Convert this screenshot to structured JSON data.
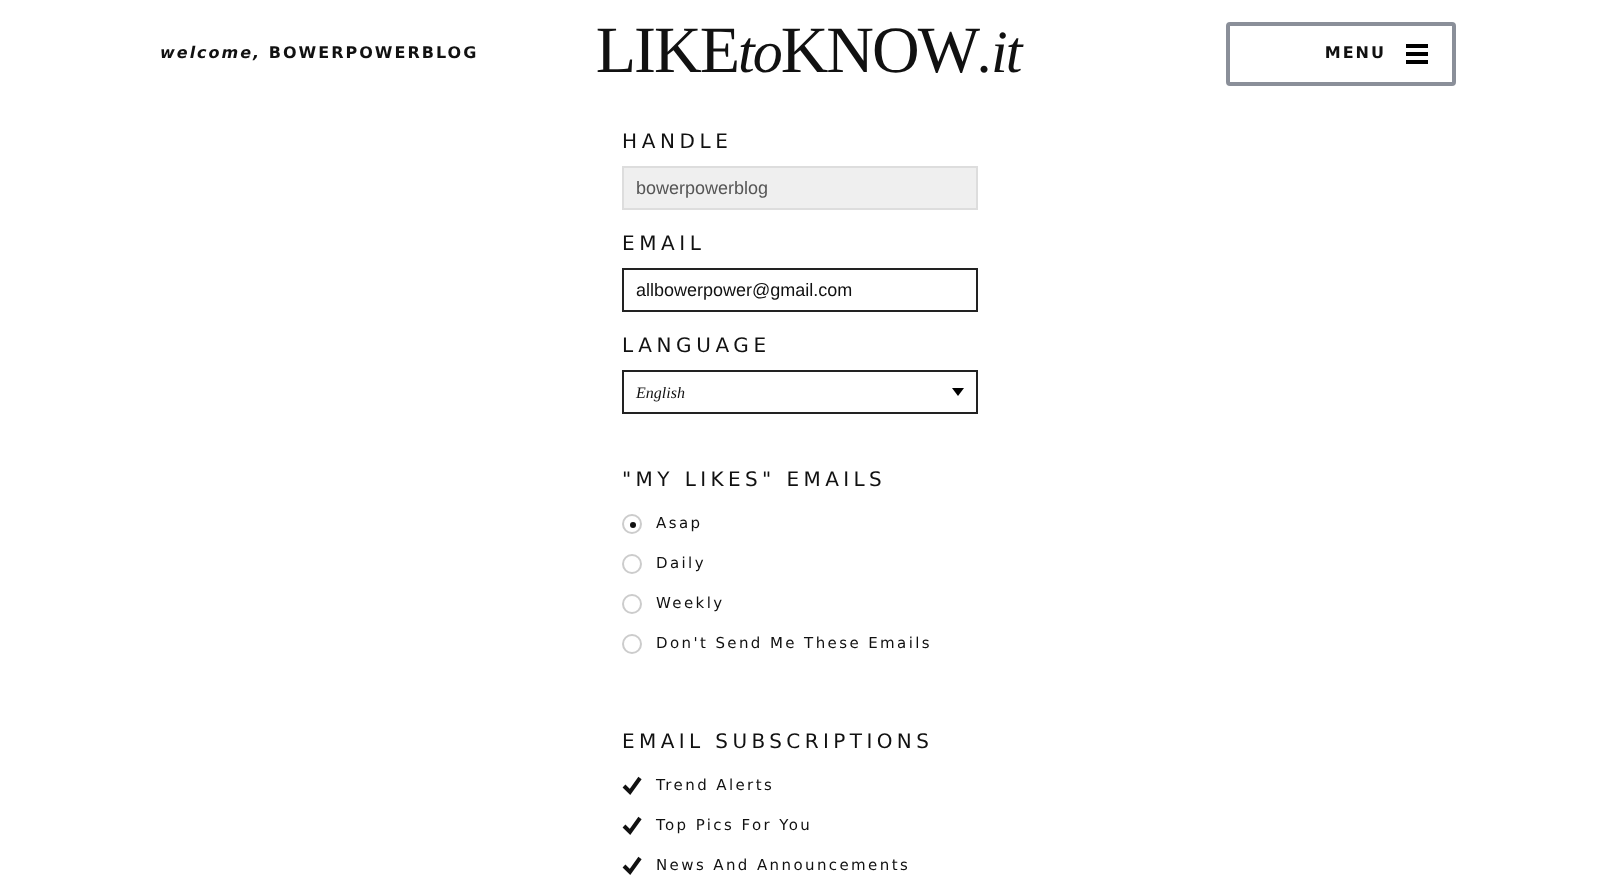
{
  "header": {
    "welcome": "*welcome,* BOWERPOWERBLOG",
    "logo": [
      {
        "text": "LIKE",
        "italic": false
      },
      {
        "text": "to",
        "italic": true
      },
      {
        "text": "KNOW",
        "italic": false
      },
      {
        "text": ".it",
        "italic": true
      }
    ],
    "menu_button": "MENU"
  },
  "form": {
    "handle": {
      "label": "HANDLE",
      "value": "bowerpowerblog",
      "disabled": true
    },
    "email": {
      "label": "EMAIL",
      "value": "allbowerpower@gmail.com",
      "disabled": false
    },
    "language": {
      "label": "LANGUAGE",
      "value": "English"
    }
  },
  "my_likes_emails": {
    "title": "\"MY LIKES\" EMAILS",
    "options": [
      {
        "label": "Asap",
        "selected": true
      },
      {
        "label": "Daily",
        "selected": false
      },
      {
        "label": "Weekly",
        "selected": false
      },
      {
        "label": "Don't Send Me These Emails",
        "selected": false
      }
    ]
  },
  "email_subscriptions": {
    "title": "EMAIL SUBSCRIPTIONS",
    "items": [
      {
        "label": "Trend Alerts",
        "checked": true
      },
      {
        "label": "Top Pics For You",
        "checked": true
      },
      {
        "label": "News And Announcements",
        "checked": true
      }
    ]
  }
}
